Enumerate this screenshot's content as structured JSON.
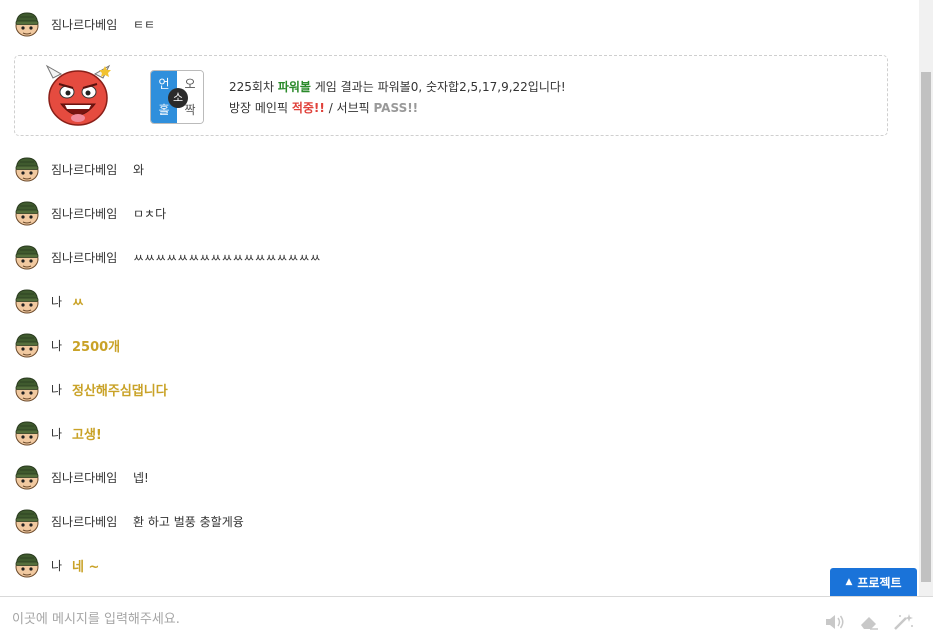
{
  "messages_top": [
    {
      "nick": "짐나르다베임",
      "text": "ㅌㅌ"
    }
  ],
  "result_card": {
    "grid": {
      "top_left": "언",
      "top_right": "오",
      "bottom_left": "홀",
      "bottom_right": "짝",
      "center": "소"
    },
    "line1_prefix": "225회차 ",
    "line1_game": "파워볼",
    "line1_suffix": " 게임 결과는 파워볼0, 숫자합2,5,17,9,22입니다!",
    "line2_main_label": "방장 메인픽 ",
    "line2_main_result": "적중!!",
    "line2_sep": " / 서브픽 ",
    "line2_sub_result": "PASS!!"
  },
  "messages": [
    {
      "nick": "짐나르다베임",
      "text": "와",
      "me": false
    },
    {
      "nick": "짐나르다베임",
      "text": "ㅁㅊ다",
      "me": false
    },
    {
      "nick": "짐나르다베임",
      "text": "ㅆㅆㅆㅆㅆㅆㅆㅆㅆㅆㅆㅆㅆㅆㅆㅆㅆ",
      "me": false
    },
    {
      "nick": "나",
      "text": "ㅆ",
      "me": true
    },
    {
      "nick": "나",
      "text": "2500개",
      "me": true
    },
    {
      "nick": "나",
      "text": "정산해주심댑니다",
      "me": true
    },
    {
      "nick": "나",
      "text": "고생!",
      "me": true
    },
    {
      "nick": "짐나르다베임",
      "text": "넵!",
      "me": false
    },
    {
      "nick": "짐나르다베임",
      "text": "환 하고 벌풍 충할게융",
      "me": false
    },
    {
      "nick": "나",
      "text": "네 ~",
      "me": true
    }
  ],
  "project_button": {
    "label": "프로젝트",
    "icon": "triangle-up-icon"
  },
  "input": {
    "placeholder": "이곳에 메시지를 입력해주세요.",
    "value": ""
  },
  "tools": [
    "speaker-icon",
    "eraser-icon",
    "magic-wand-icon"
  ],
  "colors": {
    "accent": "#1a73d9",
    "my_text": "#c9a227",
    "hit": "#e0413a",
    "game": "#2a8a2a"
  }
}
